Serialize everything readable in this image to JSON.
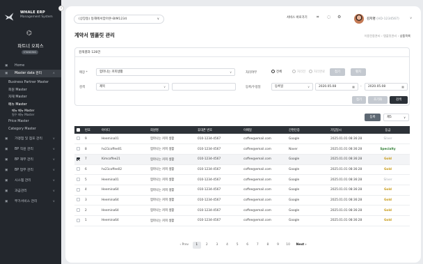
{
  "sidebar": {
    "brand_title": "WHALE ERP",
    "brand_sub": "Management System",
    "office_name": "파트너 오피스",
    "status": "STANDING",
    "menu": [
      {
        "label": "Home",
        "icon": "home-icon",
        "caret": ""
      },
      {
        "label": "Master data 관리",
        "icon": "grid-icon",
        "caret": "∧",
        "active": true
      }
    ],
    "submenu": [
      "Business Partner Master",
      "회원 Master",
      "자재 Master",
      "메뉴 Master"
    ],
    "submenu2": [
      "메뉴 메뉴 Master",
      "필수 메뉴 Master"
    ],
    "submenu_after": [
      "Price Master",
      "Category Master"
    ],
    "menu_bottom": [
      {
        "label": "가맹점 및 점포 관리",
        "icon": "store-icon",
        "caret": "∨"
      },
      {
        "label": "BP 직원 관리",
        "icon": "people-icon",
        "caret": "∨"
      },
      {
        "label": "BP 재무 관리",
        "icon": "wallet-icon",
        "caret": "∨"
      },
      {
        "label": "BP 업무 관리",
        "icon": "briefcase-icon",
        "caret": "∨"
      },
      {
        "label": "시스템 관리",
        "icon": "gear-icon",
        "caret": "∨"
      },
      {
        "label": "과금관리",
        "icon": "bill-icon",
        "caret": "∨"
      },
      {
        "label": "부가서비스 관리",
        "icon": "plus-icon",
        "caret": "∨"
      }
    ]
  },
  "header": {
    "company_select": "(상장동) 동해에서잡아온-BIM1234",
    "service_link": "서비스 바로가기",
    "user_name": "김저명",
    "user_id": "(HD-1234567)"
  },
  "page": {
    "title": "계약서 템플릿 관리",
    "breadcrumb": [
      "이용전용관리",
      "템플릿관리",
      "상품목록"
    ]
  },
  "filter": {
    "result": "검색결과 128건",
    "label_category": "매장 *",
    "category_value": "험마나는 커피생활",
    "label_status": "처리여부",
    "radio_all": "전체",
    "radio_no": "처리전",
    "radio_yes": "처리완료",
    "btn_a": "접기",
    "btn_b": "펼치",
    "label_search": "검색",
    "search_select": "제목",
    "label_date": "등록/수정일",
    "date_select": "등록일",
    "date_from": "2020.05.08",
    "date_sep": "-",
    "date_to": "2020.05.08",
    "btn_fold": "접기",
    "btn_reset": "초기화",
    "btn_search": "검색"
  },
  "list_controls": {
    "register": "등록",
    "page_size": "제5"
  },
  "table": {
    "headers": [
      "번호",
      "아이디",
      "회원명",
      "휴대폰 번호",
      "이메일",
      "간편인증",
      "가입일시",
      "등급"
    ],
    "rows": [
      [
        "9",
        "Heemina01",
        "험마나는 커피 생활",
        "010-1234-4567",
        "coffee@email.com",
        "Google",
        "2025.01.01 08:36:28",
        "Silver"
      ],
      [
        "8",
        "hs21coffee01",
        "험마나는 커피 생활",
        "010-1234-4567",
        "coffee@email.com",
        "Naver",
        "2025.01.01 08:36:28",
        "Specialty"
      ],
      [
        "7",
        "Kimcoffee21",
        "험마나는 커피 생활",
        "010-1234-4567",
        "coffee@email.com",
        "Google",
        "2025.01.01 08:36:28",
        "Gold"
      ],
      [
        "6",
        "hs21coffee02",
        "험마나는 커피 생활",
        "010-1234-4567",
        "coffee@email.com",
        "Google",
        "2025.01.01 08:36:28",
        "Gold"
      ],
      [
        "5",
        "Heemina01",
        "험마나는 커피 생활",
        "010-1234-4567",
        "coffee@email.com",
        "Google",
        "2025.01.01 08:36:28",
        "Silver"
      ],
      [
        "4",
        "Heemina64",
        "험마나는 커피 생활",
        "010-1234-4567",
        "coffee@email.com",
        "Google",
        "2025.01.01 08:36:28",
        "Gold"
      ],
      [
        "3",
        "Heemina64",
        "험마나는 커피 생활",
        "010-1234-4567",
        "coffee@email.com",
        "Google",
        "2025.01.01 08:36:28",
        "Gold"
      ],
      [
        "2",
        "Heemina64",
        "험마나는 커피 생활",
        "010-1234-4567",
        "coffee@email.com",
        "Google",
        "2025.01.01 08:36:28",
        "Gold"
      ],
      [
        "1",
        "Heemina64",
        "험마나는 커피 생활",
        "010-1234-4567",
        "coffee@email.com",
        "Google",
        "2025.01.01 08:36:28",
        "Gold"
      ]
    ],
    "selected_row": 2
  },
  "pager": {
    "prev": "‹ Prev",
    "pages": [
      "1",
      "2",
      "3",
      "4",
      "5",
      "6",
      "7",
      "8",
      "9",
      "10"
    ],
    "current": "1",
    "next": "Next ›"
  },
  "colors": {
    "sidebar": "#23272d",
    "header": "#2d3238",
    "gold": "#c79a17",
    "specialty": "#2e7d32"
  }
}
